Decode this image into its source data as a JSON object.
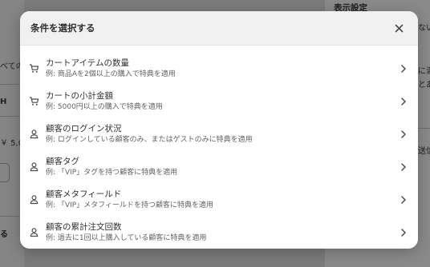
{
  "background": {
    "panel_title_fragment": "表示設定",
    "side_frag_1": "ない",
    "side_frag_2": "に満",
    "side_frag_3": "とあ",
    "side_frag_4": "送信",
    "left_frag_1": "べての",
    "left_frag_2": "H",
    "left_frag_3": "￥ 5,0",
    "left_frag_4": "る"
  },
  "modal": {
    "title": "条件を選択する",
    "close_icon": "close-icon",
    "items": [
      {
        "icon": "cart-icon",
        "title": "カートアイテムの数量",
        "description": "例: 商品Aを2個以上の購入で特典を適用"
      },
      {
        "icon": "cart-icon",
        "title": "カートの小計金額",
        "description": "例: 5000円以上の購入で特典を適用"
      },
      {
        "icon": "person-icon",
        "title": "顧客のログイン状況",
        "description": "例: ログインしている顧客のみ、またはゲストのみに特典を適用"
      },
      {
        "icon": "person-icon",
        "title": "顧客タグ",
        "description": "例: 「VIP」タグを持つ顧客に特典を適用"
      },
      {
        "icon": "person-icon",
        "title": "顧客メタフィールド",
        "description": "例: 「VIP」メタフィールドを持つ顧客に特典を適用"
      },
      {
        "icon": "person-icon",
        "title": "顧客の累計注文回数",
        "description": "例: 過去に1回以上購入している顧客に特典を適用"
      }
    ]
  }
}
